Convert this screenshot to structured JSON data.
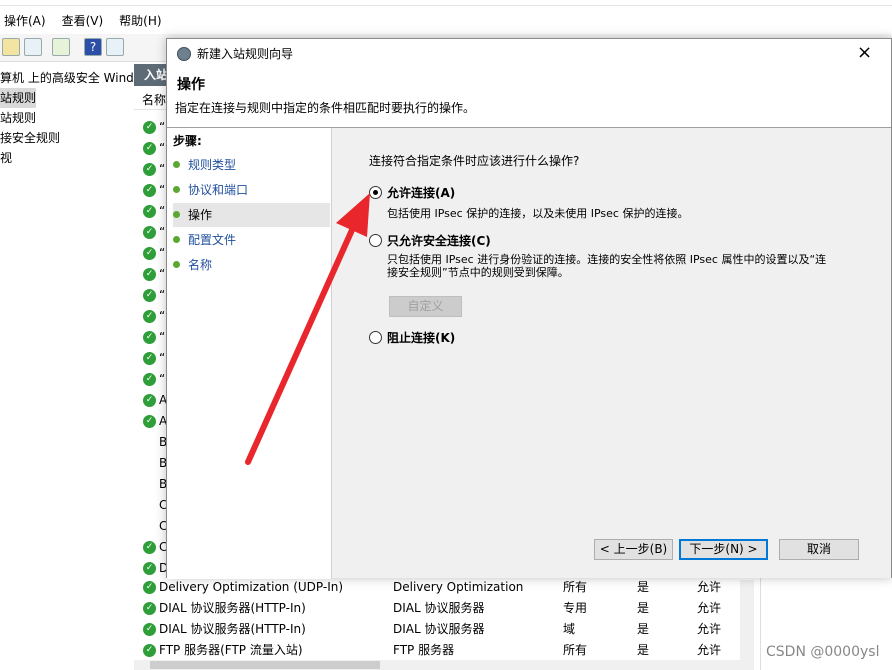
{
  "menubar": {
    "items": [
      "操作(A)",
      "查看(V)",
      "帮助(H)"
    ]
  },
  "tree": {
    "items": [
      "计算机 上的高级安全 Wind",
      "入站规则",
      "出站规则",
      "连接安全规则",
      "监视"
    ]
  },
  "list": {
    "header": "入站",
    "col_name": "名称",
    "rows": [
      {
        "name": "Delivery Optimization (UDP-In)",
        "group": "Delivery Optimization",
        "profile": "所有",
        "enabled": "是",
        "action": "允许"
      },
      {
        "name": "DIAL 协议服务器(HTTP-In)",
        "group": "DIAL 协议服务器",
        "profile": "专用",
        "enabled": "是",
        "action": "允许"
      },
      {
        "name": "DIAL 协议服务器(HTTP-In)",
        "group": "DIAL 协议服务器",
        "profile": "域",
        "enabled": "是",
        "action": "允许"
      },
      {
        "name": "FTP 服务器(FTP 流量入站)",
        "group": "FTP 服务器",
        "profile": "所有",
        "enabled": "是",
        "action": "允许"
      }
    ],
    "partial_labels": [
      "A",
      "A",
      "B",
      "B",
      "B",
      "C",
      "C",
      "C",
      "D"
    ],
    "quote_mark": "“"
  },
  "dialog": {
    "title": "新建入站规则向导",
    "close": "×",
    "heading": "操作",
    "subtitle": "指定在连接与规则中指定的条件相匹配时要执行的操作。",
    "steps_label": "步骤:",
    "steps": [
      "规则类型",
      "协议和端口",
      "操作",
      "配置文件",
      "名称"
    ],
    "question": "连接符合指定条件时应该进行什么操作?",
    "options": [
      {
        "label": "允许连接(A)",
        "desc": "包括使用 IPsec 保护的连接，以及未使用 IPsec 保护的连接。"
      },
      {
        "label": "只允许安全连接(C)",
        "desc": "只包括使用 IPsec 进行身份验证的连接。连接的安全性将依照 IPsec 属性中的设置以及“连接安全规则”节点中的规则受到保障。"
      },
      {
        "label": "阻止连接(K)",
        "desc": ""
      }
    ],
    "selected_option": 0,
    "customize": "自定义",
    "btn_back": "< 上一步(B)",
    "btn_next": "下一步(N) >",
    "btn_cancel": "取消"
  },
  "watermark": "CSDN @0000ysl",
  "colors": {
    "accent": "#0078d7",
    "check_green": "#2e9e39",
    "arrow_red": "#e8262b"
  }
}
